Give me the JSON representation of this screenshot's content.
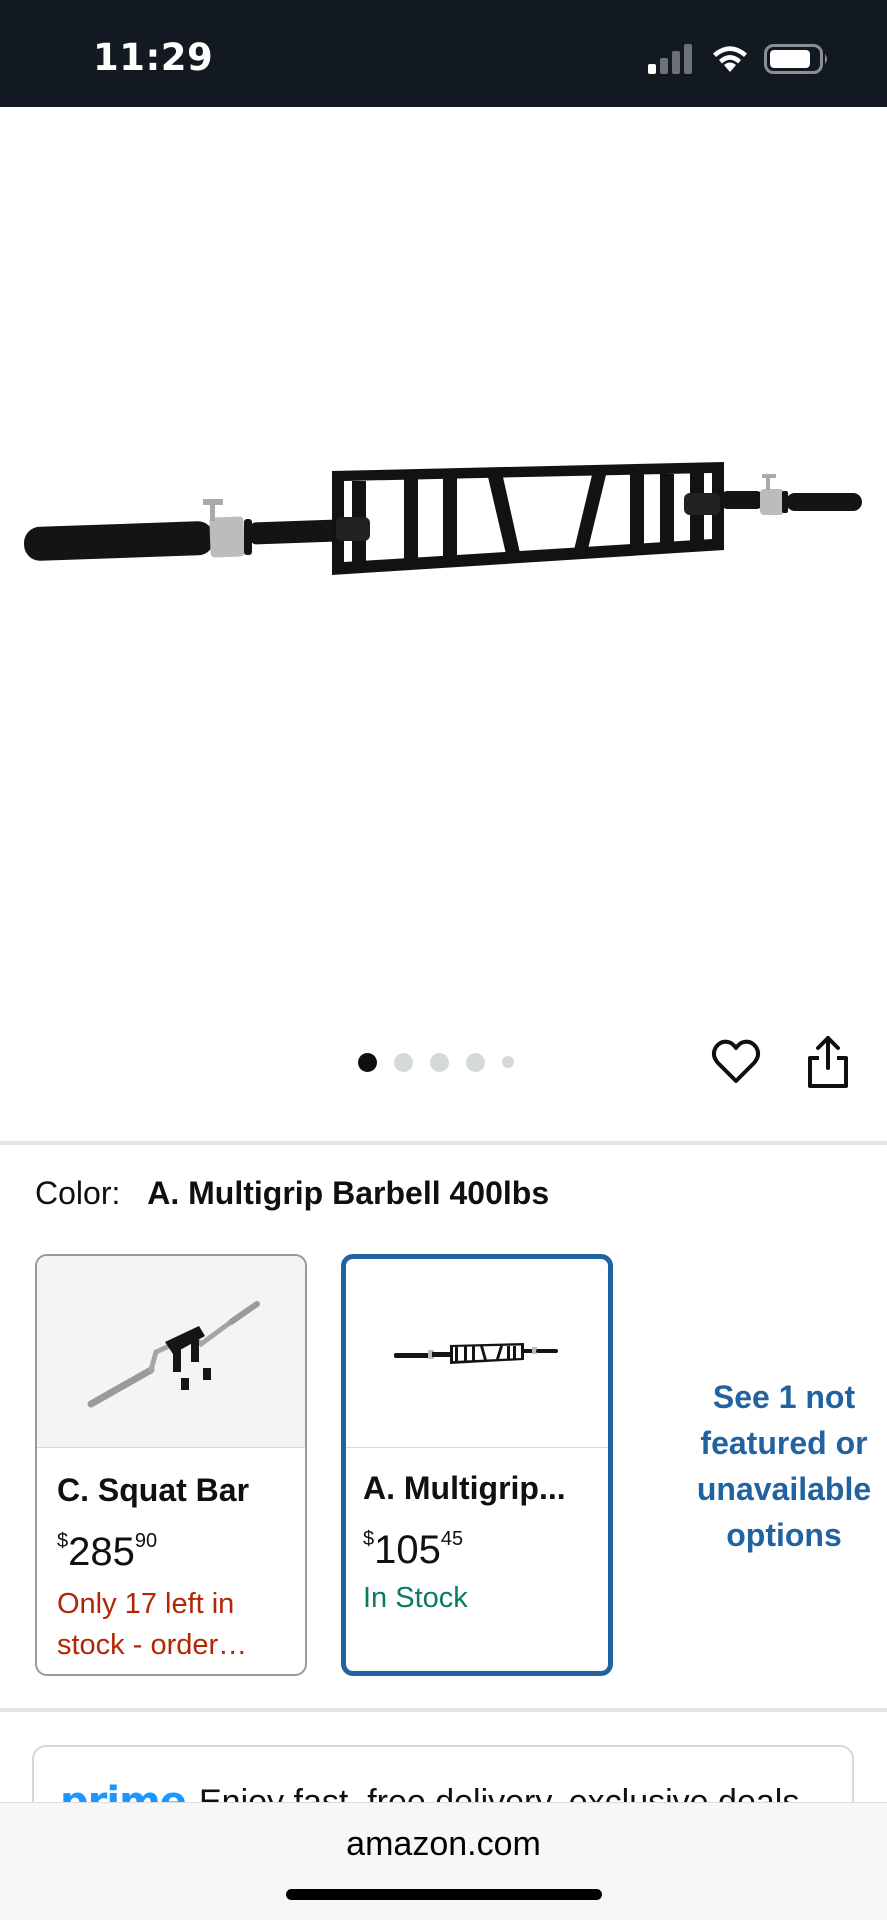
{
  "status_bar": {
    "time": "11:29"
  },
  "gallery": {
    "dots_count": 5,
    "active_index": 0
  },
  "color": {
    "label": "Color:",
    "value": "A. Multigrip Barbell 400lbs"
  },
  "swatches": [
    {
      "title": "C. Squat Bar",
      "price_symbol": "$",
      "price_whole": "285",
      "price_fraction": "90",
      "stock": "Only 17 left in stock - order…",
      "selected": false
    },
    {
      "title": "A. Multigrip...",
      "price_symbol": "$",
      "price_whole": "105",
      "price_fraction": "45",
      "stock": "In Stock",
      "selected": true
    }
  ],
  "see_more": "See 1 not featured or unavailable options",
  "prime": {
    "logo": "prime",
    "text": "Enjoy fast, free delivery, exclusive deals"
  },
  "browser": {
    "url": "amazon.com"
  },
  "colors": {
    "header_bg": "#131921",
    "link": "#2162a1",
    "low_stock": "#b12704",
    "in_stock": "#067d62",
    "prime_blue": "#1a98ff"
  }
}
